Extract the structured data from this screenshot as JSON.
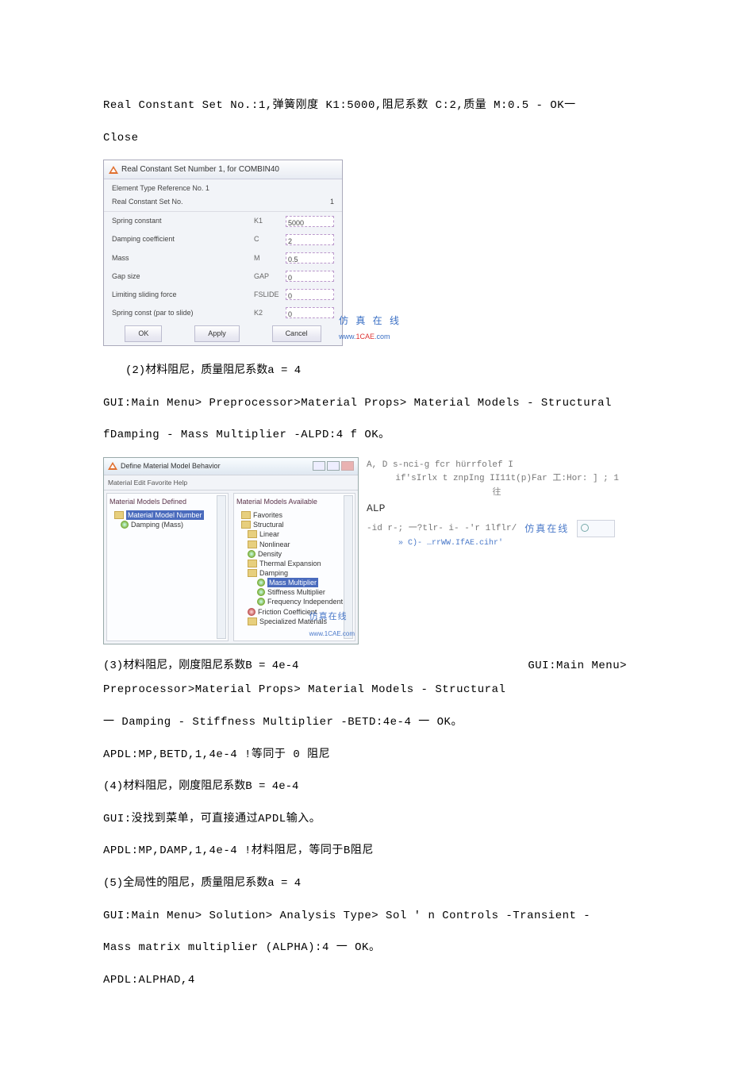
{
  "top": {
    "p1": "Real Constant Set No.:1,弹簧刚度 K1:5000,阻尼系数 C:2,质量 M:0.5 - OK一",
    "p2": "Close"
  },
  "dlg1": {
    "title": "Real Constant Set Number 1, for COMBIN40",
    "sub1": "Element Type Reference No. 1",
    "sub2": "Real Constant Set No.",
    "set_val": "1",
    "rows": [
      {
        "lab": "Spring constant",
        "code": "K1",
        "val": "5000"
      },
      {
        "lab": "Damping coefficient",
        "code": "C",
        "val": "2"
      },
      {
        "lab": "Mass",
        "code": "M",
        "val": "0.5"
      },
      {
        "lab": "Gap size",
        "code": "GAP",
        "val": "0"
      },
      {
        "lab": "Limiting sliding force",
        "code": "FSLIDE",
        "val": "0"
      },
      {
        "lab": "Spring const (par to slide)",
        "code": "K2",
        "val": "0"
      }
    ],
    "ok": "OK",
    "apply": "Apply",
    "cancel": "Cancel",
    "wm_cn": "仿 真 在 线",
    "wm_url_a": "www.",
    "wm_url_b": "1CAE",
    "wm_url_c": ".com"
  },
  "sec2": {
    "h": "(2)材料阻尼，质量阻尼系数a = 4",
    "p1": "GUI:Main Menu> Preprocessor>Material Props> Material Models - Structural",
    "p2": "fDamping - Mass Multiplier -ALPD:4 f OK。"
  },
  "mat": {
    "title": "Define Material Model Behavior",
    "menu": "Material  Edit  Favorite  Help",
    "left_head": "Material Models Defined",
    "right_head": "Material Models Available",
    "left_items": [
      {
        "t": "Material Model Number",
        "hl": true
      },
      {
        "t": "Damping (Mass)"
      }
    ],
    "right_items": [
      {
        "t": "Favorites",
        "lv": 0,
        "ic": "f"
      },
      {
        "t": "Structural",
        "lv": 0,
        "ic": "f"
      },
      {
        "t": "Linear",
        "lv": 1,
        "ic": "f"
      },
      {
        "t": "Nonlinear",
        "lv": 1,
        "ic": "f"
      },
      {
        "t": "Density",
        "lv": 1,
        "ic": "a"
      },
      {
        "t": "Thermal Expansion",
        "lv": 1,
        "ic": "f"
      },
      {
        "t": "Damping",
        "lv": 1,
        "ic": "f"
      },
      {
        "t": "Mass Multiplier",
        "lv": 2,
        "ic": "a",
        "hl": true
      },
      {
        "t": "Stiffness Multiplier",
        "lv": 2,
        "ic": "a"
      },
      {
        "t": "Frequency Independent",
        "lv": 2,
        "ic": "a"
      },
      {
        "t": "Friction Coefficient",
        "lv": 1,
        "ic": "ar"
      },
      {
        "t": "Specialized Materials",
        "lv": 1,
        "ic": "f"
      }
    ],
    "wm_cn": "仿真在线",
    "wm_url": "www.1CAE.com"
  },
  "rsnip": {
    "l1": "A, D s-nci-g fcr hürrfolef I",
    "l2": "if'sIrlx t znpIng II11t(p)Far 工:Hor: ] ; 1",
    "mid": "往",
    "alp": "ALP",
    "dash": "-id r-;  一?tlr- i- -'r 1lflr/",
    "wm": "仿真在线",
    "credit": "» C)- …rrWW.IfAE.cihr'"
  },
  "sec3": {
    "h": "(3)材料阻尼，刚度阻尼系数B = 4e-4",
    "gui_label": "GUI:Main Menu>",
    "p1": "Preprocessor>Material Props> Material Models - Structural",
    "p2": "一 Damping - Stiffness Multiplier -BETD:4e-4 一 OK。",
    "p3": "APDL:MP,BETD,1,4e-4 !等同于 0 阻尼"
  },
  "sec4": {
    "h": "(4)材料阻尼，刚度阻尼系数B = 4e-4",
    "p1": "GUI:没找到菜单，可直接通过APDL输入。",
    "p2": "APDL:MP,DAMP,1,4e-4 !材料阻尼，等同于B阻尼"
  },
  "sec5": {
    "h": "(5)全局性的阻尼，质量阻尼系数a = 4",
    "p1": "GUI:Main Menu> Solution> Analysis Type> Sol ' n Controls -Transient -",
    "p2": "Mass matrix multiplier (ALPHA):4 一 OK。",
    "p3": "APDL:ALPHAD,4"
  }
}
